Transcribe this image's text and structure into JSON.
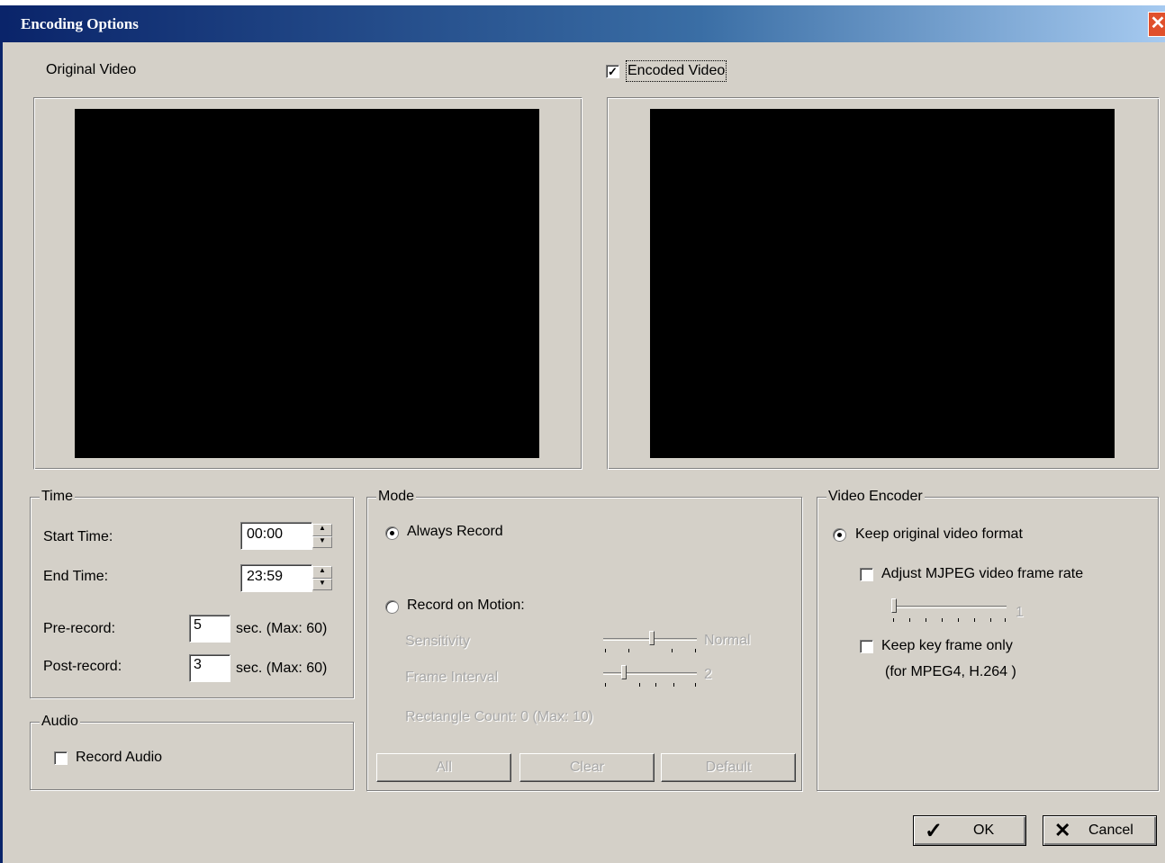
{
  "window": {
    "title": "Encoding Options",
    "close_glyph": "✕"
  },
  "preview": {
    "original_label": "Original Video",
    "encoded_label": "Encoded Video",
    "encoded_checked": true
  },
  "time": {
    "legend": "Time",
    "start_label": "Start Time:",
    "start_value": "00:00",
    "end_label": "End Time:",
    "end_value": "23:59",
    "pre_label": "Pre-record:",
    "pre_value": "5",
    "pre_unit": "sec.  (Max: 60)",
    "post_label": "Post-record:",
    "post_value": "3",
    "post_unit": "sec.  (Max: 60)"
  },
  "audio": {
    "legend": "Audio",
    "record_label": "Record Audio",
    "record_checked": false
  },
  "mode": {
    "legend": "Mode",
    "always_label": "Always Record",
    "always_selected": true,
    "motion_label": "Record on Motion:",
    "motion_selected": false,
    "sensitivity_label": "Sensitivity",
    "sensitivity_value": "Normal",
    "interval_label": "Frame Interval",
    "interval_value": "2",
    "rect_count_label": "Rectangle Count: 0  (Max: 10)",
    "btn_all": "All",
    "btn_clear": "Clear",
    "btn_default": "Default"
  },
  "encoder": {
    "legend": "Video Encoder",
    "keep_format_label": "Keep original video format",
    "keep_format_selected": true,
    "adjust_mjpeg_label": "Adjust MJPEG video frame rate",
    "adjust_mjpeg_checked": false,
    "frame_rate_value": "1",
    "keyframe_label": "Keep key frame only",
    "keyframe_checked": false,
    "keyframe_note": "(for MPEG4, H.264 )"
  },
  "footer": {
    "ok_label": "OK",
    "ok_icon": "✓",
    "cancel_label": "Cancel",
    "cancel_icon": "✕"
  }
}
